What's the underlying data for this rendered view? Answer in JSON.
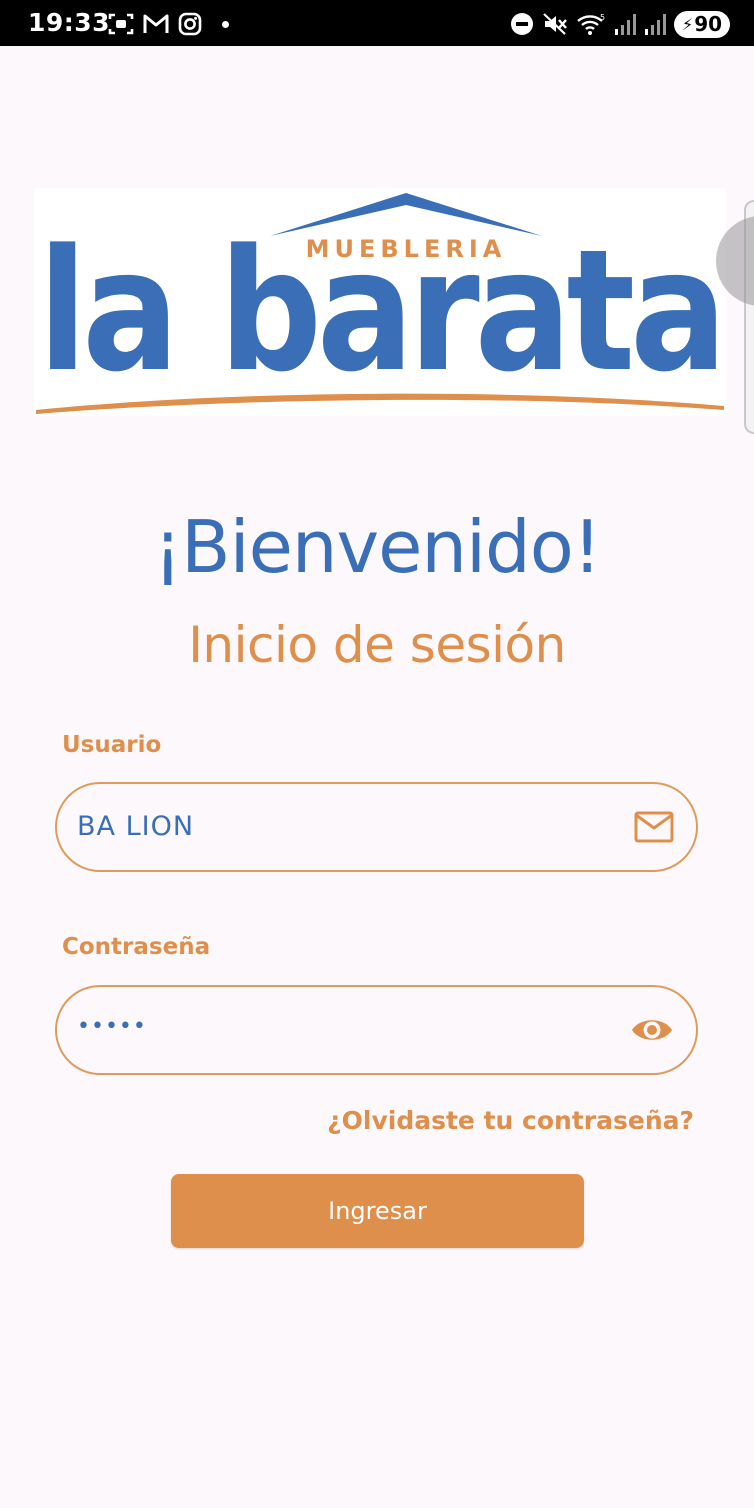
{
  "status_bar": {
    "time": "19:33",
    "battery_level": "90",
    "left_icons": [
      "screenshot-icon",
      "gmail-icon",
      "instagram-icon",
      "notification-dot"
    ],
    "right_icons": [
      "do-not-disturb-icon",
      "mute-icon",
      "wifi-icon",
      "signal-icon",
      "signal-icon",
      "battery-icon"
    ]
  },
  "logo": {
    "top_text": "MUEBLERIA",
    "brand_text": "la barata",
    "colors": {
      "blue": "#3a6fb7",
      "orange": "#de8f4b"
    }
  },
  "welcome": {
    "title": "¡Bienvenido!",
    "subtitle": "Inicio de sesión"
  },
  "form": {
    "username": {
      "label": "Usuario",
      "value": "BA LION",
      "icon": "mail-icon"
    },
    "password": {
      "label": "Contraseña",
      "value": "•••••",
      "icon": "eye-icon"
    },
    "forgot_link": "¿Olvidaste tu contraseña?",
    "submit_label": "Ingresar"
  },
  "theme": {
    "primary_blue": "#3a6fb7",
    "accent_orange": "#de8f4b",
    "background": "#fdf8fc"
  }
}
